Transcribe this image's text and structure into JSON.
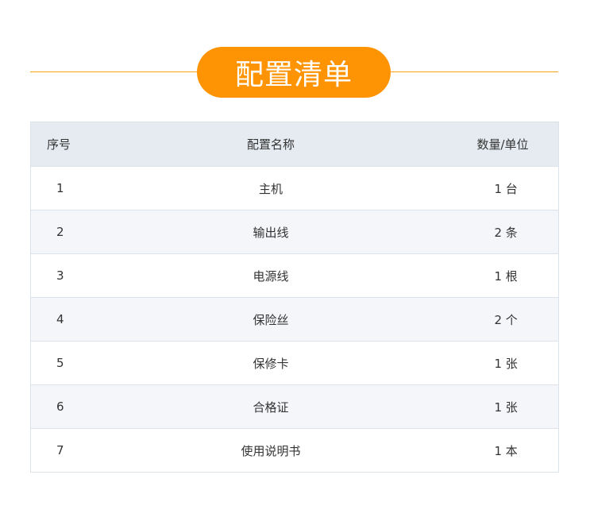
{
  "title": "配置清单",
  "table": {
    "headers": {
      "no": "序号",
      "name": "配置名称",
      "qty": "数量/单位"
    },
    "rows": [
      {
        "no": "1",
        "name": "主机",
        "qty": "1 台"
      },
      {
        "no": "2",
        "name": "输出线",
        "qty": "2 条"
      },
      {
        "no": "3",
        "name": "电源线",
        "qty": "1 根"
      },
      {
        "no": "4",
        "name": "保险丝",
        "qty": "2 个"
      },
      {
        "no": "5",
        "name": "保修卡",
        "qty": "1 张"
      },
      {
        "no": "6",
        "name": "合格证",
        "qty": "1 张"
      },
      {
        "no": "7",
        "name": "使用说明书",
        "qty": "1 本"
      }
    ]
  },
  "colors": {
    "accent": "#fe9404",
    "line": "#f7a21b",
    "header_bg": "#e6ebf1",
    "stripe_bg": "#f4f6f9",
    "border": "#dde3ea",
    "text": "#333333"
  }
}
